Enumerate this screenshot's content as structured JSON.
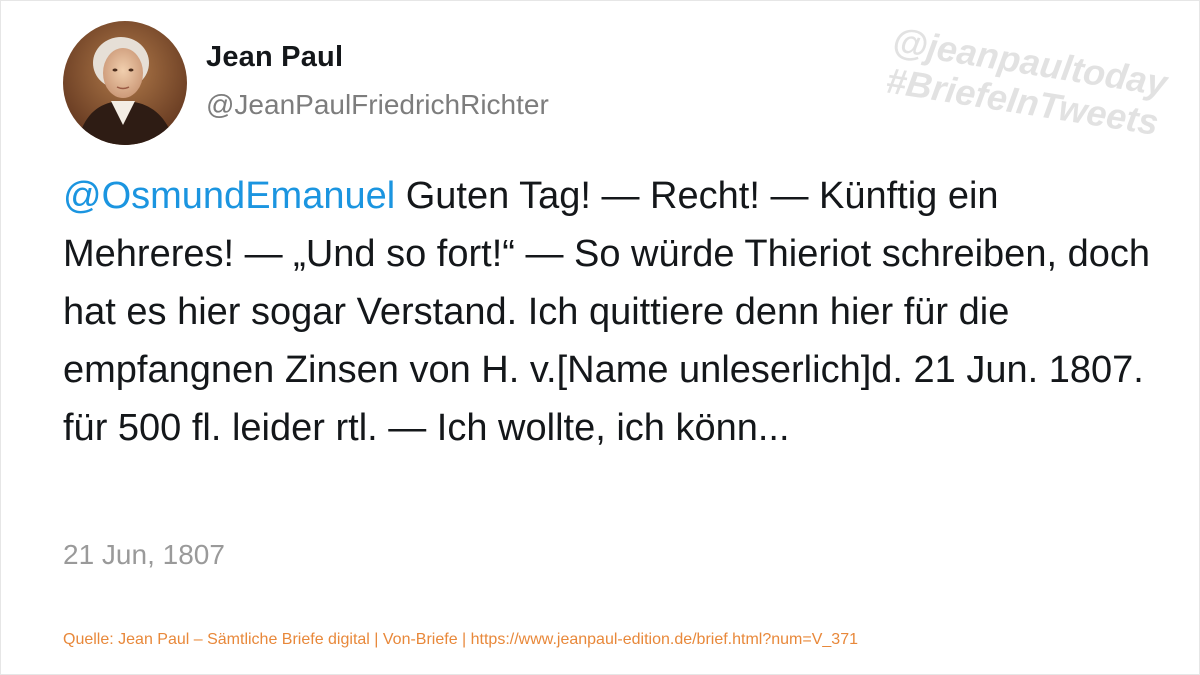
{
  "tweet": {
    "display_name": "Jean Paul",
    "handle": "@JeanPaulFriedrichRichter",
    "mention": "@OsmundEmanuel",
    "body": " Guten Tag! — Recht! — Künftig ein Mehreres! — „Und so fort!“ — So würde Thieriot schreiben, doch hat es hier sogar Verstand. Ich quittiere denn hier für die empfangnen Zinsen von H. v.[Name unleserlich]d. 21 Jun. 1807. für 500 fl. leider rtl. — Ich wollte, ich könn...",
    "date": "21 Jun, 1807",
    "avatar_icon": "portrait-avatar"
  },
  "watermark": {
    "line1": "@jeanpaultoday",
    "line2": "#BriefeInTweets"
  },
  "footer": {
    "source": "Quelle: Jean Paul – Sämtliche Briefe digital | Von-Briefe | https://www.jeanpaul-edition.de/brief.html?num=V_371"
  },
  "colors": {
    "mention": "#1b95e0",
    "source": "#e8883a",
    "watermark": "#e2e2e2"
  }
}
